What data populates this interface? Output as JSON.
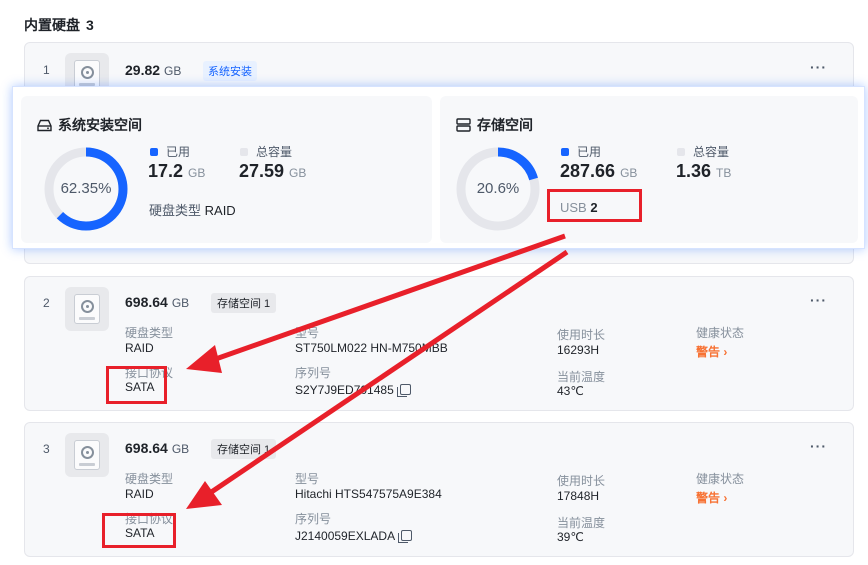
{
  "section": {
    "title": "内置硬盘",
    "count": "3"
  },
  "disks": [
    {
      "index": "1",
      "capacity": "29.82",
      "unit": "GB",
      "tag": "系统安装",
      "more": "···"
    },
    {
      "index": "2",
      "capacity": "698.64",
      "unit": "GB",
      "tag": "存储空间 1",
      "more": "···",
      "type_label": "硬盘类型",
      "type_value": "RAID",
      "interface_label": "接口协议",
      "interface_value": "SATA",
      "model_label": "型号",
      "model_value": "ST750LM022 HN-M750MBB",
      "serial_label": "序列号",
      "serial_value": "S2Y7J9ED701485",
      "usage_label": "使用时长",
      "usage_value": "16293H",
      "temp_label": "当前温度",
      "temp_value": "43℃",
      "health_label": "健康状态",
      "health_value": "警告"
    },
    {
      "index": "3",
      "capacity": "698.64",
      "unit": "GB",
      "tag": "存储空间 1",
      "more": "···",
      "type_label": "硬盘类型",
      "type_value": "RAID",
      "interface_label": "接口协议",
      "interface_value": "SATA",
      "model_label": "型号",
      "model_value": "Hitachi HTS547575A9E384",
      "serial_label": "序列号",
      "serial_value": "J2140059EXLADA",
      "usage_label": "使用时长",
      "usage_value": "17848H",
      "temp_label": "当前温度",
      "temp_value": "39℃",
      "health_label": "健康状态",
      "health_value": "警告"
    }
  ],
  "system_space": {
    "title": "系统安装空间",
    "percent_label": "62.35%",
    "percent": 62.35,
    "used_label": "已用",
    "used_value": "17.2",
    "used_unit": "GB",
    "total_label": "总容量",
    "total_value": "27.59",
    "total_unit": "GB",
    "type_label": "硬盘类型",
    "type_value": "RAID"
  },
  "storage_space": {
    "title": "存储空间",
    "percent_label": "20.6%",
    "percent": 20.6,
    "used_label": "已用",
    "used_value": "287.66",
    "used_unit": "GB",
    "total_label": "总容量",
    "total_value": "1.36",
    "total_unit": "TB",
    "usb_label": "USB",
    "usb_value": "2"
  },
  "colors": {
    "accent": "#1664ff",
    "track": "#e5e6eb",
    "warning": "#f77234",
    "annotation": "#e8202a"
  },
  "icons": {
    "disk": "hard-disk-icon",
    "system_space": "drive-icon",
    "storage_space": "storage-stack-icon",
    "more": "more-dots-icon",
    "copy": "copy-icon",
    "chevron": "chevron-right-icon"
  }
}
